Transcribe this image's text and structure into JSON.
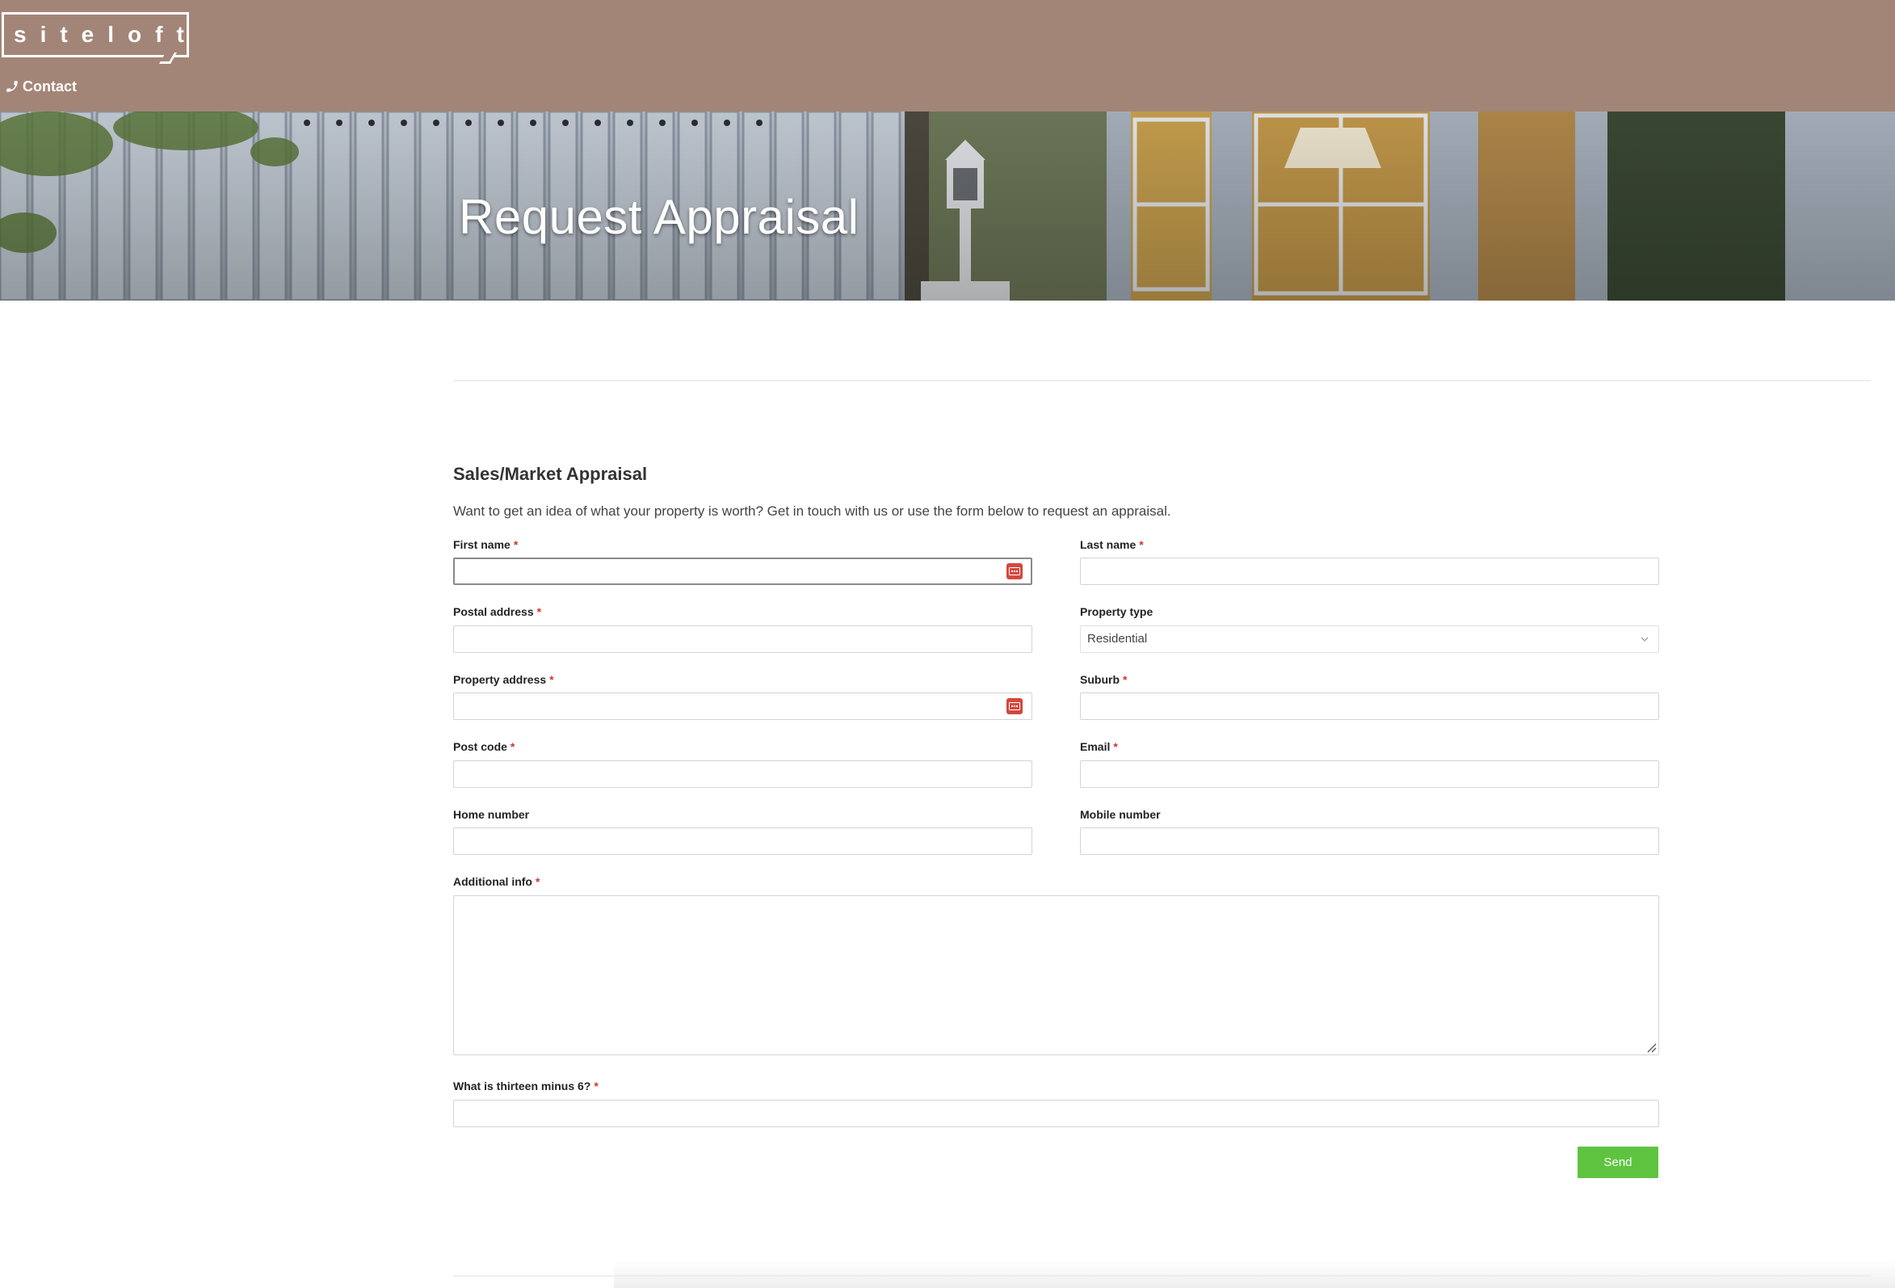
{
  "header": {
    "logo_text": "siteloft",
    "contact_label": "Contact"
  },
  "hero": {
    "title": "Request Appraisal"
  },
  "form": {
    "title": "Sales/Market Appraisal",
    "intro": "Want to get an idea of what your property is worth? Get in touch with us or use the form below to request an appraisal.",
    "required_marker": "*",
    "fields": {
      "first_name": {
        "label": "First name",
        "value": ""
      },
      "last_name": {
        "label": "Last name",
        "value": ""
      },
      "postal_address": {
        "label": "Postal address",
        "value": ""
      },
      "property_type": {
        "label": "Property type",
        "value": "Residential"
      },
      "property_address": {
        "label": "Property address",
        "value": ""
      },
      "suburb": {
        "label": "Suburb",
        "value": ""
      },
      "post_code": {
        "label": "Post code",
        "value": ""
      },
      "email": {
        "label": "Email",
        "value": ""
      },
      "home_number": {
        "label": "Home number",
        "value": ""
      },
      "mobile_number": {
        "label": "Mobile number",
        "value": ""
      },
      "additional_info": {
        "label": "Additional info",
        "value": ""
      },
      "captcha": {
        "label": "What is thirteen minus 6?",
        "value": ""
      }
    },
    "send_label": "Send"
  },
  "colors": {
    "header_bg": "#a38577",
    "send_button": "#5ec440",
    "required": "#d43333",
    "password_manager_icon": "#d4483d"
  },
  "icons": {
    "contact": "phone-icon",
    "password_manager": "password-manager-icon",
    "select": "chevron-down-icon"
  }
}
